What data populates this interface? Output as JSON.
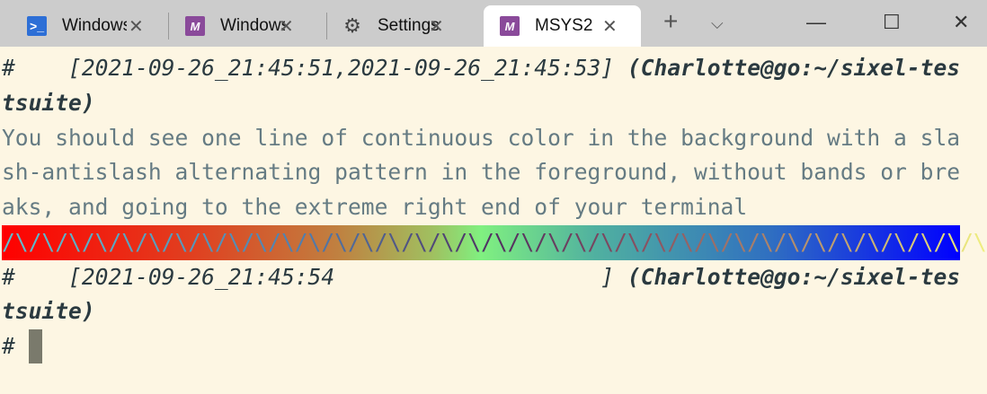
{
  "tabs": [
    {
      "label": "Windows PowerShell",
      "icon": "powershell-icon",
      "active": false
    },
    {
      "label": "Windows",
      "icon": "msys2-icon",
      "active": false
    },
    {
      "label": "Settings",
      "icon": "gear-icon",
      "active": false
    },
    {
      "label": "MSYS2",
      "icon": "msys2-icon",
      "active": true
    }
  ],
  "controls": {
    "new_tab": "+",
    "dropdown": "⌵",
    "minimize": "—",
    "maximize": "☐",
    "close": "✕"
  },
  "terminal": {
    "prompt1_hash": "#",
    "prompt1_time": "    [2021-09-26_21:45:51,2021-09-26_21:45:53]",
    "prompt1_path": " (Charlotte@go:~/sixel-testsuite)",
    "message": "You should see one line of continuous color in the background with a slash-antislash alternating pattern in the foreground, without bands or breaks, and going to the extreme right end of your terminal",
    "pattern": "/\\/\\/\\/\\/\\/\\/\\/\\/\\/\\/\\/\\/\\/\\/\\/\\/\\/\\/\\/\\/\\/\\/\\/\\/\\/\\/\\/\\/\\/\\/\\/\\/\\/\\/\\/\\/\\",
    "prompt2_hash": "#",
    "prompt2_time": "    [2021-09-26_21:45:54                    ]",
    "prompt2_path": " (Charlotte@go:~/sixel-testsuite)",
    "prompt3_hash": "# "
  },
  "colors": {
    "background": "#fdf6e3",
    "text": "#2b3a40",
    "message": "#657b83",
    "cursor": "#7a7a6c"
  }
}
